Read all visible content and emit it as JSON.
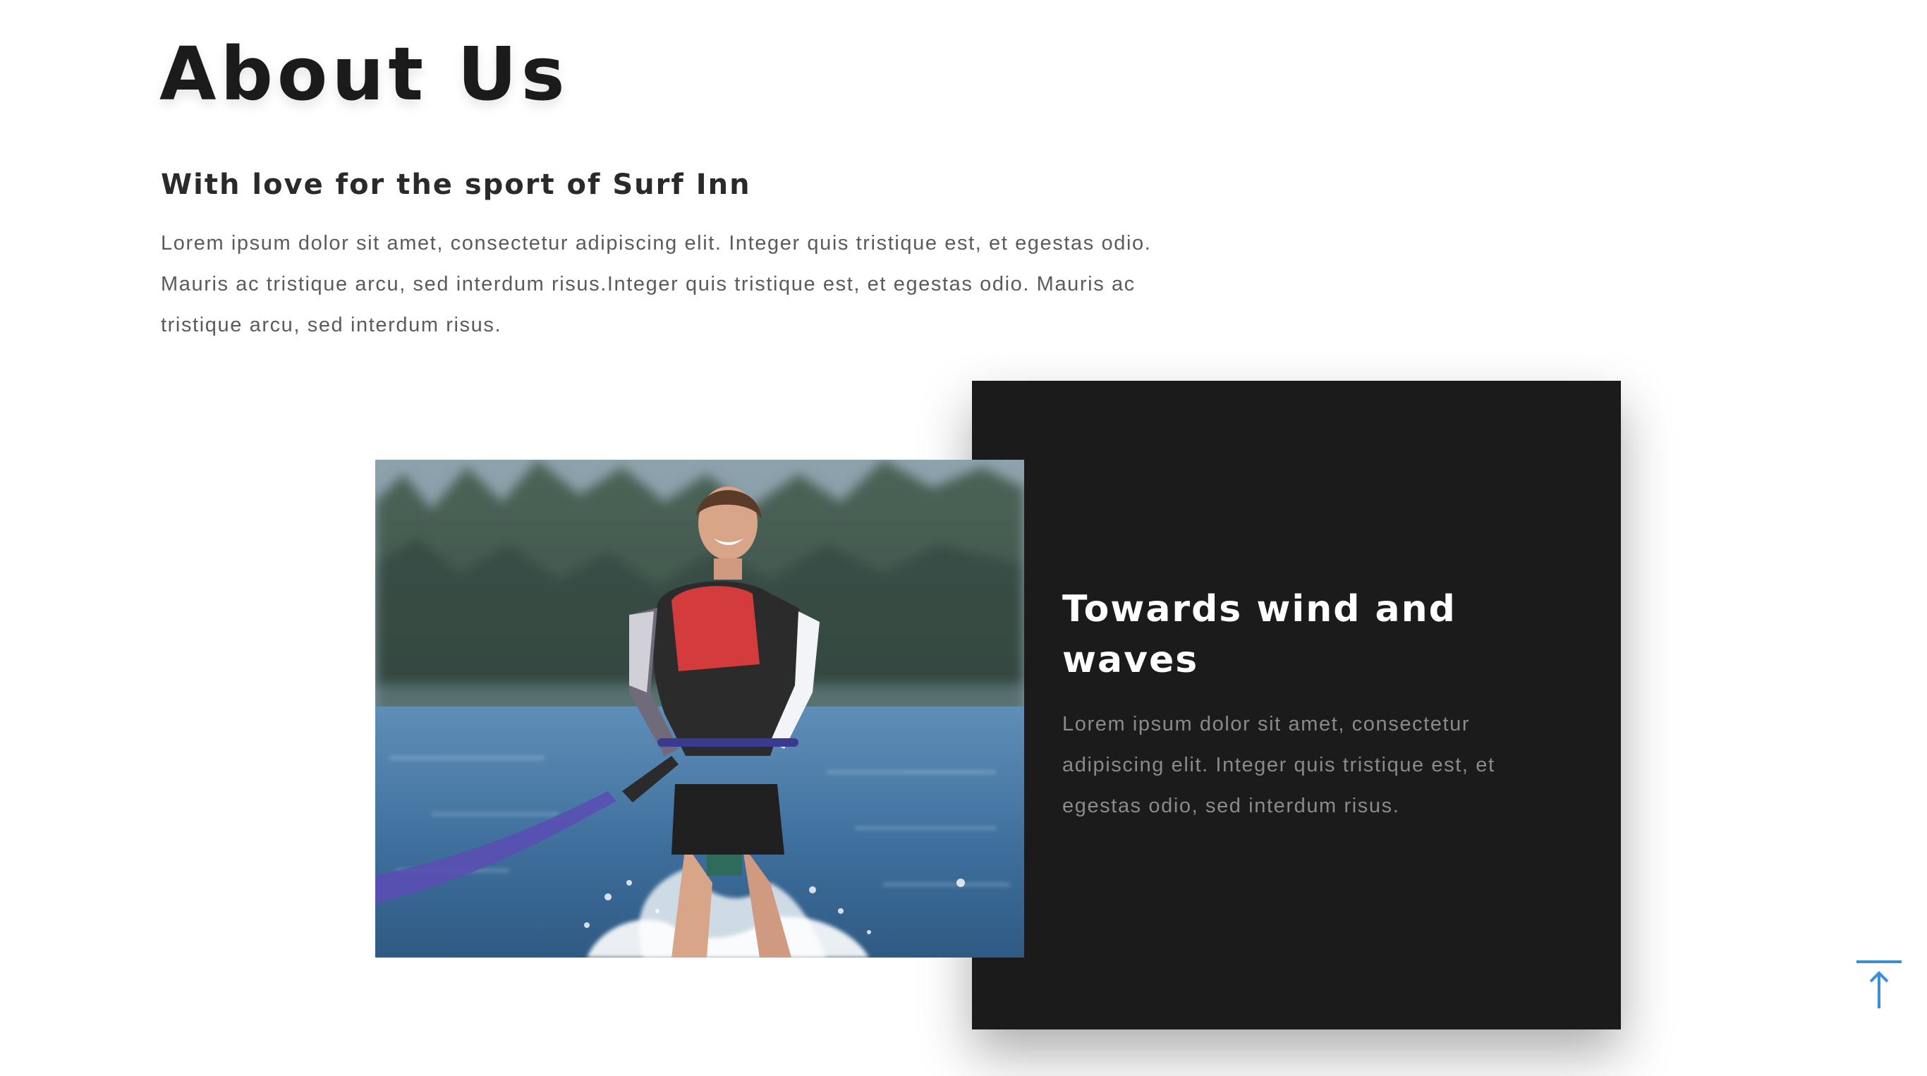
{
  "about": {
    "title": "About Us",
    "subtitle": "With love for the sport of Surf Inn",
    "intro": "Lorem ipsum dolor sit amet, consectetur adipiscing elit. Integer quis tristique est, et egestas odio. Mauris ac tristique arcu, sed interdum risus.Integer quis tristique est, et egestas odio. Mauris ac tristique arcu, sed interdum risus."
  },
  "feature": {
    "photo_icon": "water-skier-photo",
    "title": "Towards wind and waves",
    "text": "Lorem ipsum dolor sit amet, consectetur adipiscing elit. Integer quis tristique est, et egestas odio, sed interdum risus."
  },
  "back_to_top": {
    "icon": "arrow-up-icon"
  },
  "colors": {
    "background": "#ffffff",
    "heading": "#1b1b1b",
    "body_text": "#5b5b5b",
    "card_background": "#1b1b1b",
    "card_heading": "#ffffff",
    "card_text": "#8a8a8a",
    "accent": "#3b8fd6"
  }
}
